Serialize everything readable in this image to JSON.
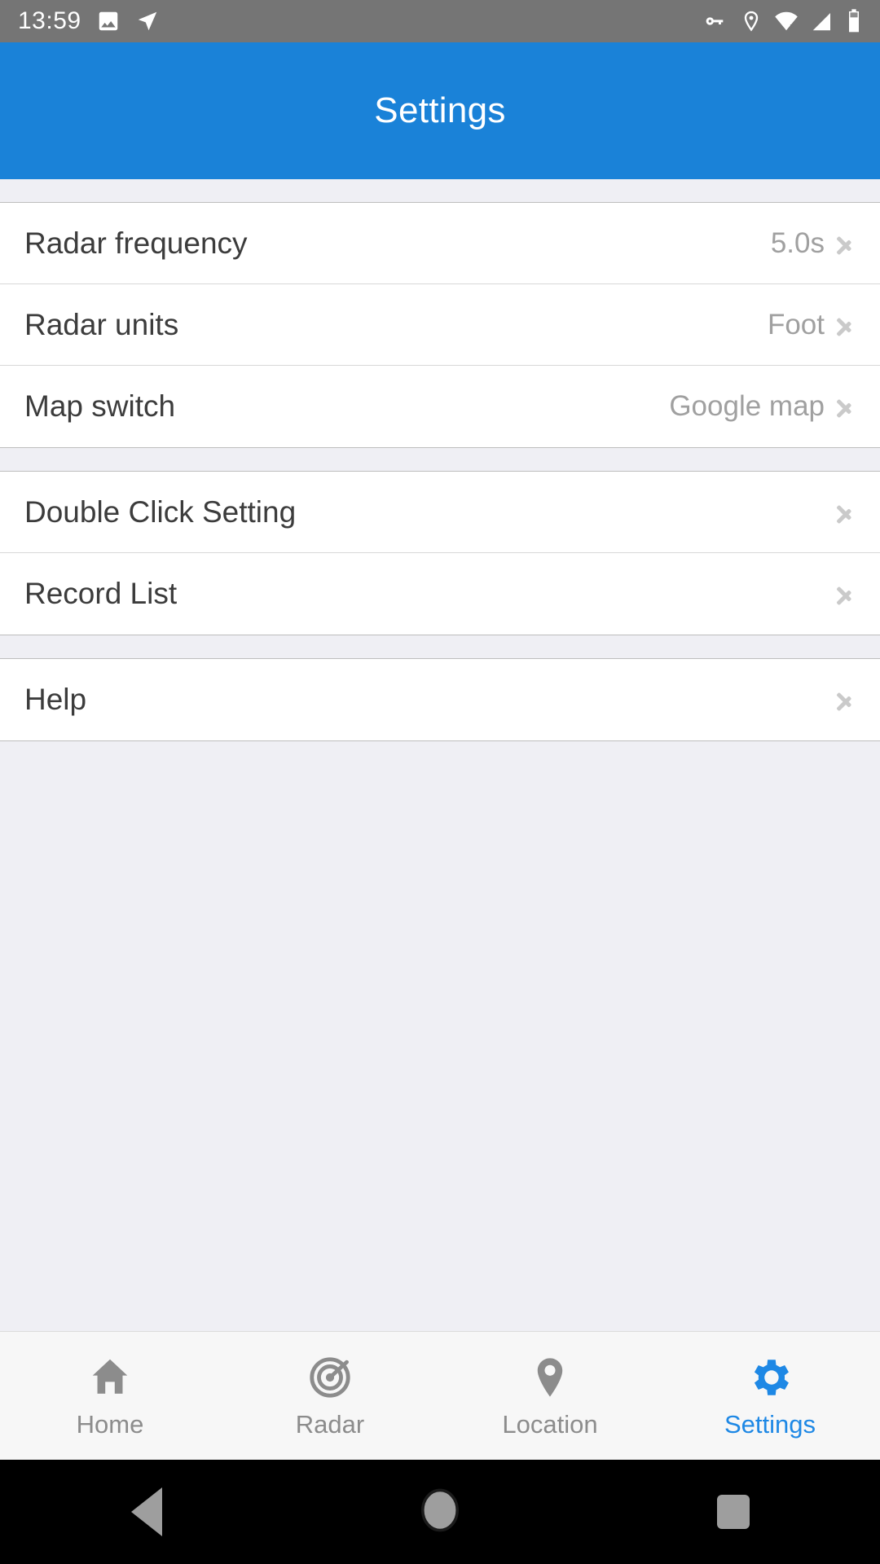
{
  "status_bar": {
    "time": "13:59",
    "left_icons": [
      "image-icon",
      "navigation-send-icon"
    ],
    "right_icons": [
      "key-icon",
      "location-pin-icon",
      "wifi-off-icon",
      "cellular-signal-icon",
      "battery-icon"
    ],
    "background": "#757575"
  },
  "header": {
    "title": "Settings",
    "background": "#1A82D8",
    "text_color": "#FFFFFF"
  },
  "groups": [
    {
      "rows": [
        {
          "label": "Radar frequency",
          "value": "5.0s",
          "chevron": true
        },
        {
          "label": "Radar units",
          "value": "Foot",
          "chevron": true
        },
        {
          "label": "Map switch",
          "value": "Google map",
          "chevron": true
        }
      ]
    },
    {
      "rows": [
        {
          "label": "Double Click Setting",
          "value": "",
          "chevron": true
        },
        {
          "label": "Record List",
          "value": "",
          "chevron": true
        }
      ]
    },
    {
      "rows": [
        {
          "label": "Help",
          "value": "",
          "chevron": true
        }
      ]
    }
  ],
  "tabbar": {
    "background": "#F7F7F7",
    "active_color": "#1E88E5",
    "inactive_color": "#8C8C8C",
    "tabs": [
      {
        "label": "Home",
        "icon": "home-icon",
        "active": false
      },
      {
        "label": "Radar",
        "icon": "radar-target-icon",
        "active": false
      },
      {
        "label": "Location",
        "icon": "location-pin-icon",
        "active": false
      },
      {
        "label": "Settings",
        "icon": "gear-icon",
        "active": true
      }
    ]
  },
  "navbar": {
    "background": "#000000",
    "buttons": [
      "back-triangle-icon",
      "home-circle-icon",
      "recents-square-icon"
    ]
  }
}
